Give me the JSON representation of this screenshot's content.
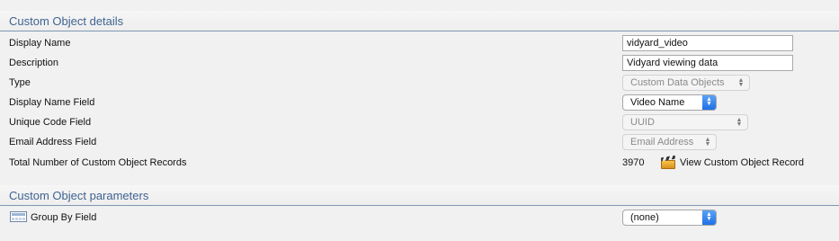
{
  "details": {
    "title": "Custom Object details",
    "display_name": {
      "label": "Display Name",
      "value": "vidyard_video"
    },
    "description": {
      "label": "Description",
      "value": "Vidyard viewing data"
    },
    "type": {
      "label": "Type",
      "value": "Custom Data Objects"
    },
    "display_name_field": {
      "label": "Display Name Field",
      "value": "Video Name"
    },
    "unique_code_field": {
      "label": "Unique Code Field",
      "value": "UUID"
    },
    "email_address_field": {
      "label": "Email Address Field",
      "value": "Email Address"
    },
    "total_records": {
      "label": "Total Number of Custom Object Records",
      "count": "3970",
      "link": "View Custom Object Record"
    }
  },
  "parameters": {
    "title": "Custom Object parameters",
    "group_by": {
      "label": "Group By Field",
      "value": "(none)"
    }
  }
}
